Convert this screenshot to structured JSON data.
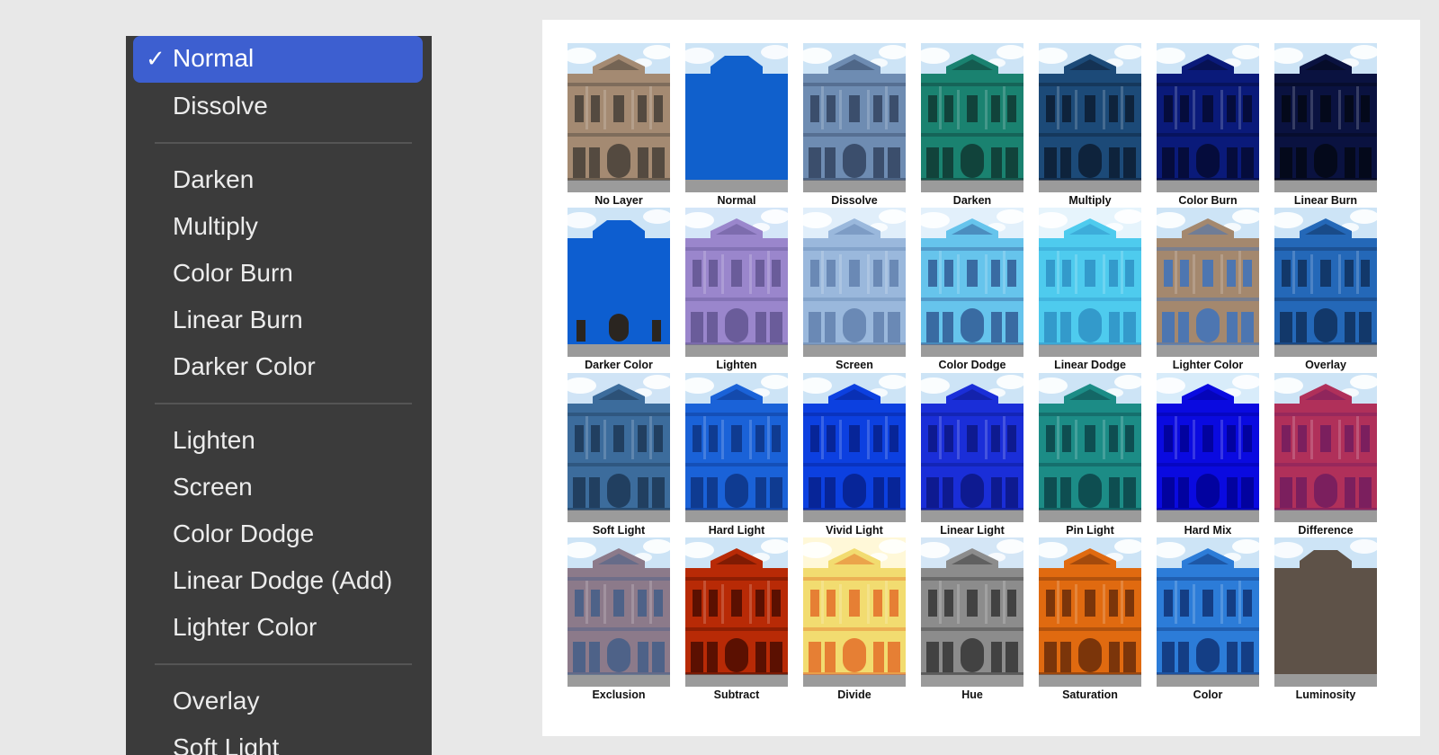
{
  "blend_menu": {
    "items": [
      {
        "label": "Normal",
        "selected": true
      },
      {
        "label": "Dissolve"
      },
      {
        "separator": true
      },
      {
        "label": "Darken"
      },
      {
        "label": "Multiply"
      },
      {
        "label": "Color Burn"
      },
      {
        "label": "Linear Burn"
      },
      {
        "label": "Darker Color"
      },
      {
        "separator": true
      },
      {
        "label": "Lighten"
      },
      {
        "label": "Screen"
      },
      {
        "label": "Color Dodge"
      },
      {
        "label": "Linear Dodge (Add)"
      },
      {
        "label": "Lighter Color"
      },
      {
        "separator": true
      },
      {
        "label": "Overlay"
      },
      {
        "label": "Soft Light"
      }
    ],
    "check_glyph": "✓"
  },
  "blend_grid": {
    "cells": [
      {
        "label": "No Layer",
        "wall": "#a48a72",
        "sky": "#cde4f6",
        "dark": "#3a3530"
      },
      {
        "label": "Normal",
        "wall": "#1060cc",
        "sky": "#cde4f6",
        "dark": "#1060cc",
        "solid": true
      },
      {
        "label": "Dissolve",
        "wall": "#6e8cb2",
        "sky": "#cde4f6",
        "dark": "#2a3a55"
      },
      {
        "label": "Darken",
        "wall": "#1a8270",
        "sky": "#cde4f6",
        "dark": "#0e2e2a"
      },
      {
        "label": "Multiply",
        "wall": "#1c4a78",
        "sky": "#cde4f6",
        "dark": "#0a1628"
      },
      {
        "label": "Color Burn",
        "wall": "#0a1a7a",
        "sky": "#cde4f6",
        "dark": "#040828"
      },
      {
        "label": "Linear Burn",
        "wall": "#0a1240",
        "sky": "#cde4f6",
        "dark": "#03060f"
      },
      {
        "label": "Darker Color",
        "wall": "#0d5ed0",
        "sky": "#cde4f6",
        "dark": "#2a2520",
        "solid": true
      },
      {
        "label": "Lighten",
        "wall": "#9a86cc",
        "sky": "#d4e6f8",
        "dark": "#5a4e8a"
      },
      {
        "label": "Screen",
        "wall": "#9ab8dc",
        "sky": "#e0eefa",
        "dark": "#5a7aa8"
      },
      {
        "label": "Color Dodge",
        "wall": "#66c4ec",
        "sky": "#e2f0fb",
        "dark": "#2a4e8a"
      },
      {
        "label": "Linear Dodge",
        "wall": "#4ecbee",
        "sky": "#e6f4fc",
        "dark": "#2a8ac0"
      },
      {
        "label": "Lighter Color",
        "wall": "#a4886e",
        "sky": "#cde4f6",
        "dark": "#3070c8"
      },
      {
        "label": "Overlay",
        "wall": "#2468b8",
        "sky": "#cde4f6",
        "dark": "#0d2850"
      },
      {
        "label": "Soft Light",
        "wall": "#3c6c9c",
        "sky": "#d0e4f6",
        "dark": "#18304c"
      },
      {
        "label": "Hard Light",
        "wall": "#1a62d8",
        "sky": "#cde4f6",
        "dark": "#0c2e7a"
      },
      {
        "label": "Vivid Light",
        "wall": "#0c40e0",
        "sky": "#cde4f6",
        "dark": "#061c80"
      },
      {
        "label": "Linear Light",
        "wall": "#1a2ed8",
        "sky": "#cde4f6",
        "dark": "#0a1478"
      },
      {
        "label": "Pin Light",
        "wall": "#1c8c86",
        "sky": "#cde4f6",
        "dark": "#0a3a40"
      },
      {
        "label": "Hard Mix",
        "wall": "#0a0ae0",
        "sky": "#d8ecfa",
        "dark": "#00008a"
      },
      {
        "label": "Difference",
        "wall": "#b0305a",
        "sky": "#cde4f6",
        "dark": "#6a1a60"
      },
      {
        "label": "Exclusion",
        "wall": "#8c7a8a",
        "sky": "#cde4f6",
        "dark": "#3a5a88"
      },
      {
        "label": "Subtract",
        "wall": "#b82a06",
        "sky": "#cde4f6",
        "dark": "#3c0800"
      },
      {
        "label": "Divide",
        "wall": "#f2dc70",
        "sky": "#fff8d8",
        "dark": "#e26020"
      },
      {
        "label": "Hue",
        "wall": "#8c8c8c",
        "sky": "#d4e6f6",
        "dark": "#2a2a2a"
      },
      {
        "label": "Saturation",
        "wall": "#e06a10",
        "sky": "#cde4f6",
        "dark": "#5a2408"
      },
      {
        "label": "Color",
        "wall": "#2c7cd8",
        "sky": "#cde4f6",
        "dark": "#0c2a6a"
      },
      {
        "label": "Luminosity",
        "wall": "#5e5248",
        "sky": "#cde4f6",
        "dark": "#4a3e34",
        "solid": true
      }
    ]
  }
}
